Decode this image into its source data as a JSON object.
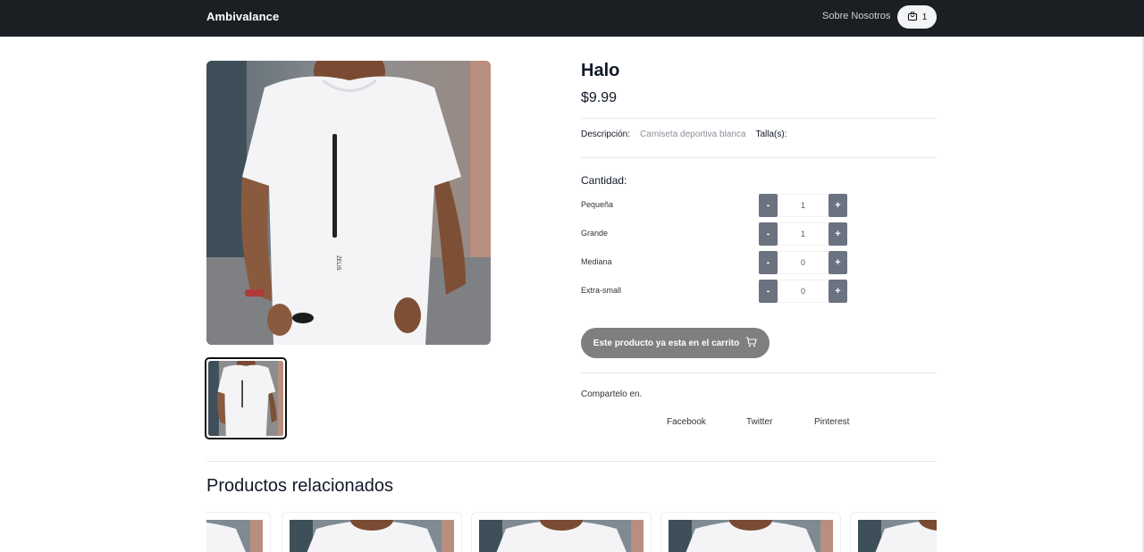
{
  "header": {
    "brand": "Ambivalance",
    "about_link": "Sobre Nosotros",
    "cart_count": "1",
    "cart_icon": "shopping-bag-icon"
  },
  "product": {
    "title": "Halo",
    "price": "$9.99",
    "description_label": "Descripción:",
    "description_value": "Camiseta deportiva blanca",
    "sizes_label": "Talla(s):",
    "quantity_title": "Cantidad:",
    "quantities": [
      {
        "name": "Pequeña",
        "value": "1",
        "minus": "-",
        "plus": "+"
      },
      {
        "name": "Grande",
        "value": "1",
        "minus": "-",
        "plus": "+"
      },
      {
        "name": "Mediana",
        "value": "0",
        "minus": "-",
        "plus": "+"
      },
      {
        "name": "Extra-small",
        "value": "0",
        "minus": "-",
        "plus": "+"
      }
    ],
    "cart_button": "Este producto ya esta en el carrito",
    "cart_button_icon": "cart-icon",
    "shirt_print": "ZELIS"
  },
  "share": {
    "label": "Compartelo en.",
    "links": [
      "Facebook",
      "Twitter",
      "Pinterest"
    ]
  },
  "related": {
    "title": "Productos relacionados"
  },
  "colors": {
    "header_bg": "#1b1e22",
    "stepper_button": "#6b7280",
    "cart_button_bg": "#7f7f7f"
  }
}
